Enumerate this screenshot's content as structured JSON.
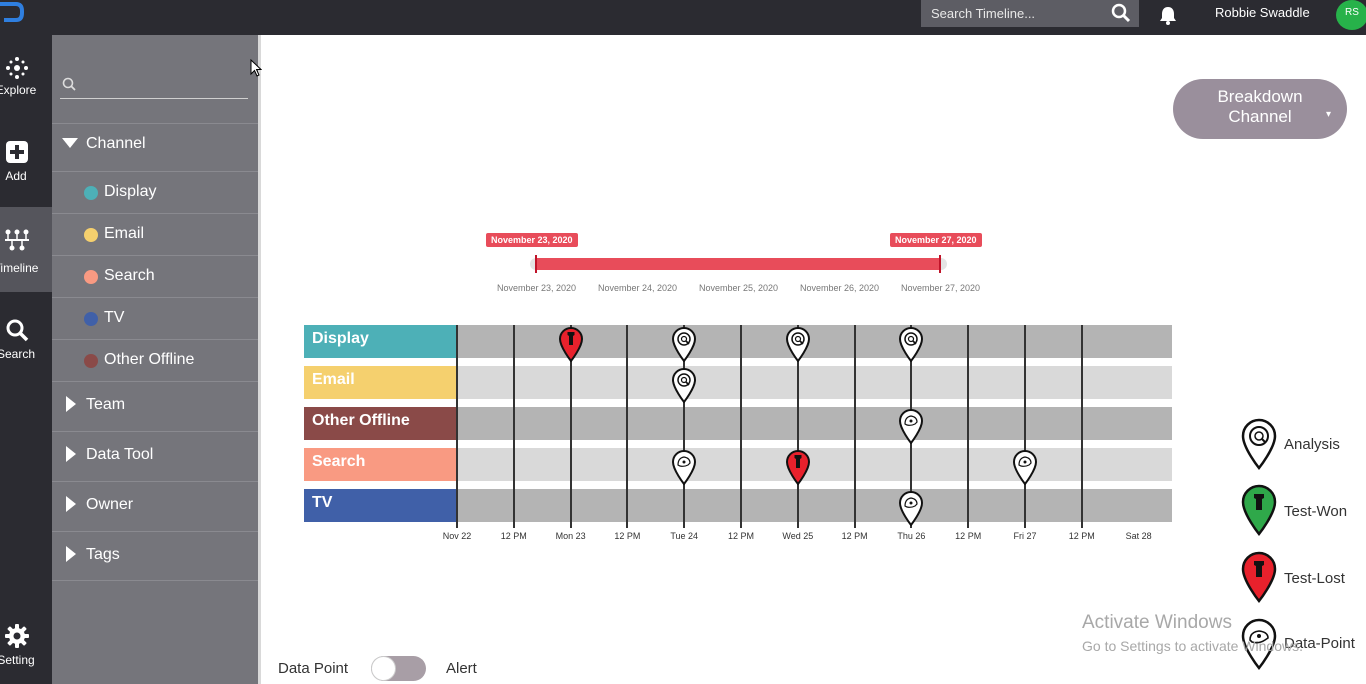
{
  "topbar": {
    "search_placeholder": "Search Timeline...",
    "username": "Robbie Swaddle",
    "avatar_initials": "RS"
  },
  "rail": {
    "items": [
      {
        "label": "Explore",
        "icon": "explore-icon"
      },
      {
        "label": "Add",
        "icon": "plus-box-icon"
      },
      {
        "label": "Timeline",
        "icon": "timeline-icon"
      },
      {
        "label": "Search",
        "icon": "search-icon"
      },
      {
        "label": "Setting",
        "icon": "gear-icon"
      }
    ],
    "active": "Timeline"
  },
  "panel": {
    "search_placeholder": "",
    "channel_label": "Channel",
    "channels": [
      {
        "label": "Display",
        "color": "#4db0b7"
      },
      {
        "label": "Email",
        "color": "#f5d06e"
      },
      {
        "label": "Search",
        "color": "#f99a82"
      },
      {
        "label": "TV",
        "color": "#4060a8"
      },
      {
        "label": "Other Offline",
        "color": "#8a4a48"
      }
    ],
    "groups": [
      "Team",
      "Data Tool",
      "Owner",
      "Tags"
    ]
  },
  "breakdown": {
    "line1": "Breakdown",
    "line2": "Channel",
    "caret": "▾"
  },
  "range": {
    "start_label": "November 23, 2020",
    "end_label": "November 27, 2020",
    "ticks": [
      "November 23, 2020",
      "November 24, 2020",
      "November 25, 2020",
      "November 26, 2020",
      "November 27, 2020"
    ]
  },
  "timeline": {
    "rows": [
      {
        "label": "Display",
        "color": "#4db0b7",
        "markers": [
          {
            "pos": 2,
            "type": "Test-Lost"
          },
          {
            "pos": 4,
            "type": "Analysis"
          },
          {
            "pos": 6,
            "type": "Analysis"
          },
          {
            "pos": 8,
            "type": "Analysis"
          }
        ]
      },
      {
        "label": "Email",
        "color": "#f5d06e",
        "markers": [
          {
            "pos": 4,
            "type": "Analysis"
          }
        ]
      },
      {
        "label": "Other Offline",
        "color": "#8a4a48",
        "markers": [
          {
            "pos": 8,
            "type": "Data-Point"
          }
        ]
      },
      {
        "label": "Search",
        "color": "#f99a82",
        "markers": [
          {
            "pos": 4,
            "type": "Data-Point"
          },
          {
            "pos": 6,
            "type": "Test-Lost"
          },
          {
            "pos": 10,
            "type": "Data-Point"
          }
        ]
      },
      {
        "label": "TV",
        "color": "#4060a8",
        "markers": [
          {
            "pos": 8,
            "type": "Data-Point"
          }
        ]
      }
    ],
    "axis_ticks": [
      "Nov 22",
      "12 PM",
      "Mon 23",
      "12 PM",
      "Tue 24",
      "12 PM",
      "Wed 25",
      "12 PM",
      "Thu 26",
      "12 PM",
      "Fri 27",
      "12 PM",
      "Sat 28"
    ]
  },
  "legend": [
    {
      "label": "Analysis",
      "color": "#ffffff"
    },
    {
      "label": "Test-Won",
      "color": "#2fa84a"
    },
    {
      "label": "Test-Lost",
      "color": "#e8212c"
    },
    {
      "label": "Data-Point",
      "color": "#ffffff"
    }
  ],
  "toggle": {
    "left_label": "Data Point",
    "right_label": "Alert",
    "state": "Data Point"
  },
  "watermark": {
    "line1": "Activate Windows",
    "line2": "Go to Settings to activate Windows."
  }
}
